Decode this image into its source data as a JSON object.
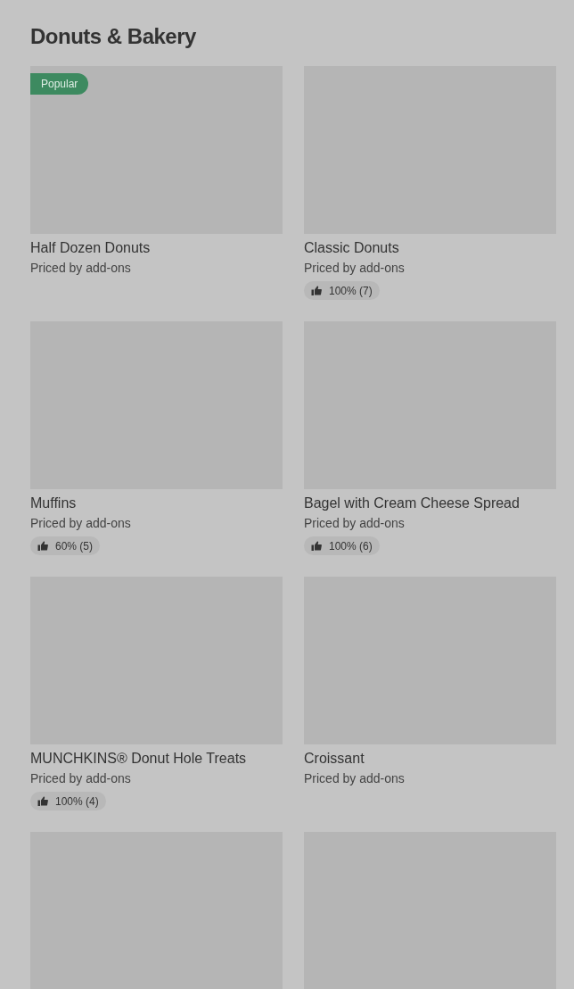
{
  "section": {
    "title": "Donuts & Bakery"
  },
  "items": [
    {
      "kind": "product",
      "badge": "Popular",
      "name": "Half Dozen Donuts",
      "price": "Priced by add-ons"
    },
    {
      "kind": "product",
      "name": "Classic Donuts",
      "price": "Priced by add-ons",
      "rating": "100% (7)"
    },
    {
      "kind": "product",
      "name": "Muffins",
      "price": "Priced by add-ons",
      "rating": "60% (5)"
    },
    {
      "kind": "product",
      "name": "Bagel with Cream Cheese Spread",
      "price": "Priced by add-ons",
      "rating": "100% (6)"
    },
    {
      "kind": "product",
      "name": "MUNCHKINS® Donut Hole Treats",
      "price": "Priced by add-ons",
      "rating": "100% (4)"
    },
    {
      "kind": "product",
      "name": "Croissant",
      "price": "Priced by add-ons"
    },
    {
      "kind": "picture"
    },
    {
      "kind": "picture"
    }
  ]
}
